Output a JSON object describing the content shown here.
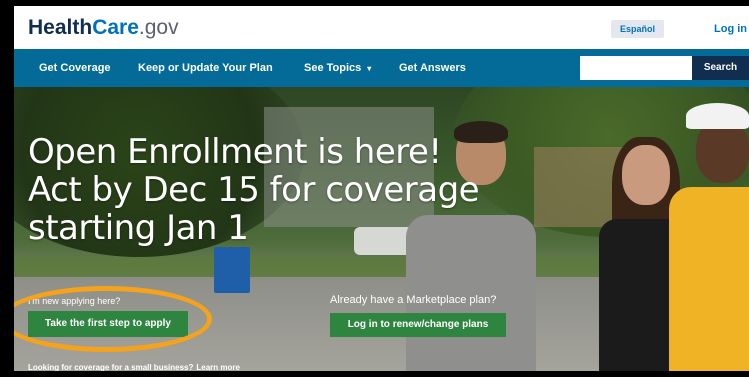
{
  "header": {
    "logo": {
      "part1": "Health",
      "part2": "Care",
      "part3": ".gov"
    },
    "language_label": "Español",
    "login_label": "Log in"
  },
  "nav": {
    "items": [
      {
        "label": "Get Coverage"
      },
      {
        "label": "Keep or Update Your Plan"
      },
      {
        "label": "See Topics"
      },
      {
        "label": "Get Answers"
      }
    ],
    "see_topics_caret": "▾",
    "search": {
      "value": "",
      "placeholder": "",
      "button_label": "Search"
    }
  },
  "hero": {
    "title_line1": "Open Enrollment is here!",
    "title_line2": "Act by Dec 15 for coverage",
    "title_line3": "starting Jan 1",
    "left_cta": {
      "label": "I'm new applying here?",
      "button_label": "Take the first step to apply"
    },
    "right_cta": {
      "label": "Already have a Marketplace plan?",
      "button_label": "Log in to renew/change plans"
    },
    "small_business": {
      "text": "Looking for coverage for a small business?",
      "link_label": "Learn more"
    }
  },
  "colors": {
    "nav_bg": "#046b99",
    "cta_green": "#2e8540",
    "highlight_ring": "#f5a21c",
    "link_blue": "#0071bc"
  }
}
